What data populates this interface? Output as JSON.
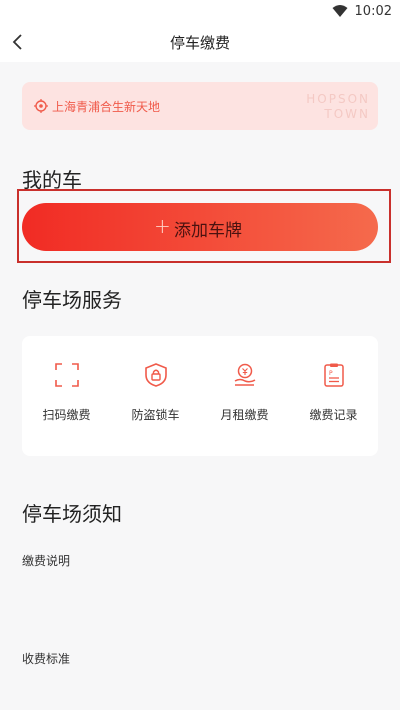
{
  "status_bar": {
    "time": "10:02",
    "icon": "wifi-icon"
  },
  "nav": {
    "title": "停车缴费",
    "back_icon": "chevron-left-icon"
  },
  "location": {
    "name": "上海青浦合生新天地",
    "watermark_line1": "HOPSON",
    "watermark_line2": "TOWN",
    "icon": "location-pin-icon"
  },
  "my_car": {
    "title": "我的车",
    "add_plate_label": "添加车牌",
    "add_plate_icon": "plus-icon"
  },
  "services": {
    "title": "停车场服务",
    "items": [
      {
        "label": "扫码缴费",
        "icon": "scan-icon"
      },
      {
        "label": "防盗锁车",
        "icon": "shield-lock-icon"
      },
      {
        "label": "月租缴费",
        "icon": "monthly-rent-icon"
      },
      {
        "label": "缴费记录",
        "icon": "receipt-icon"
      }
    ]
  },
  "notice": {
    "title": "停车场须知",
    "items": [
      {
        "label": "缴费说明"
      },
      {
        "label": "收费标准"
      }
    ]
  },
  "colors": {
    "accent": "#f12b24",
    "accent_light": "#fde3e1",
    "highlight_frame": "#c9302c",
    "icon_red": "#f05a4a"
  }
}
